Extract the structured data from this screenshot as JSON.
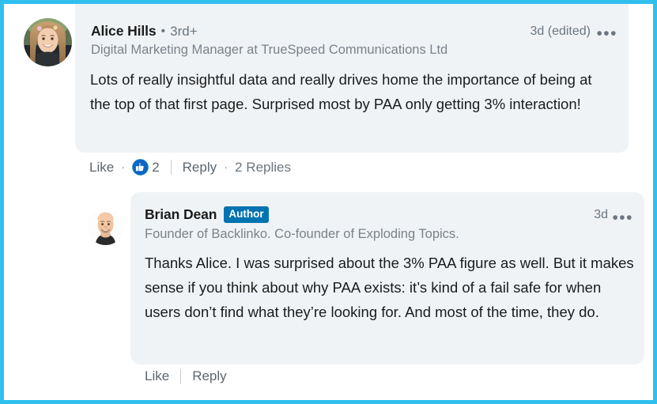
{
  "theme": {
    "frame_border_color": "#2fc0ee",
    "card_background": "#f0f3f6",
    "page_background": "#ffffff",
    "author_badge_color": "#0073b1",
    "like_icon_color": "#0a66c2",
    "primary_text_color": "#1b1b1b",
    "secondary_text_color": "#6b7680"
  },
  "comment": {
    "author": {
      "avatar": "alice-avatar-photo",
      "name": "Alice Hills",
      "separator": "•",
      "degree": "3rd+",
      "headline": "Digital Marketing Manager at TrueSpeed Communications Ltd"
    },
    "timestamp": "3d (edited)",
    "menu_icon": "•••",
    "body": "Lots of really insightful data and really drives home the importance of being at the top of that first page. Surprised most by PAA only getting 3% interaction!",
    "actions": {
      "like_label": "Like",
      "dot_separator": "·",
      "reaction_icon": "thumbs-up-icon",
      "reaction_count": "2",
      "reply_label": "Reply",
      "replies_count_label": "2 Replies"
    }
  },
  "reply": {
    "author": {
      "avatar": "brian-avatar-photo",
      "name": "Brian Dean",
      "badge": "Author",
      "headline": "Founder of Backlinko. Co-founder of Exploding Topics."
    },
    "timestamp": "3d",
    "menu_icon": "•••",
    "body": "Thanks Alice. I was surprised about the 3% PAA figure as well. But it makes sense if you think about why PAA exists: it’s kind of a fail safe for when users don’t find what they’re looking for. And most of the time, they do.",
    "actions": {
      "like_label": "Like",
      "reply_label": "Reply"
    }
  }
}
